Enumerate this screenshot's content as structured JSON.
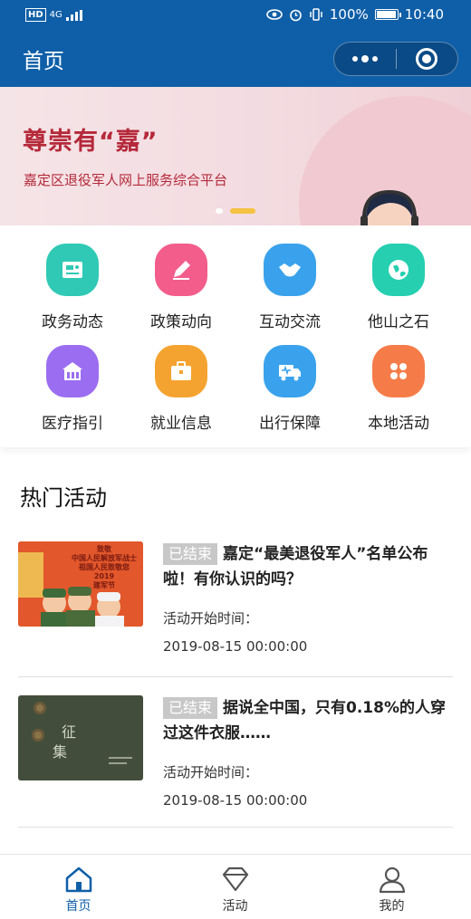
{
  "status_bar": {
    "hd": "HD",
    "signal": "4G",
    "battery": "100%",
    "time": "10:40"
  },
  "nav": {
    "title": "首页"
  },
  "banner": {
    "title": "尊崇有“嘉”",
    "subtitle": "嘉定区退役军人网上服务综合平台"
  },
  "grid": {
    "items": [
      {
        "label": "政务动态",
        "icon": "news-icon",
        "color": "#2fc9b5"
      },
      {
        "label": "政策动向",
        "icon": "pen-icon",
        "color": "#f25d8c"
      },
      {
        "label": "互动交流",
        "icon": "handshake-icon",
        "color": "#3aa2ec"
      },
      {
        "label": "他山之石",
        "icon": "globe-icon",
        "color": "#25cfb0"
      },
      {
        "label": "医疗指引",
        "icon": "hospital-icon",
        "color": "#9b6df0"
      },
      {
        "label": "就业信息",
        "icon": "briefcase-icon",
        "color": "#f5a330"
      },
      {
        "label": "出行保障",
        "icon": "truck-icon",
        "color": "#3aa2ec"
      },
      {
        "label": "本地活动",
        "icon": "flower-icon",
        "color": "#f57c48"
      }
    ]
  },
  "hot": {
    "title": "热门活动",
    "items": [
      {
        "badge": "已结束",
        "title": "嘉定“最美退役军人”名单公布啦！有你认识的吗？",
        "time_label": "活动开始时间：",
        "time": "2019-08-15 00:00:00",
        "thumb_lines": [
          "致敬",
          "中国人民解放军战士",
          "祖国人民致敬您",
          "2019",
          "建军节"
        ]
      },
      {
        "badge": "已结束",
        "title": "据说全中国，只有0.18%的人穿过这件衣服……",
        "time_label": "活动开始时间：",
        "time": "2019-08-15 00:00:00",
        "thumb_lines": [
          "征",
          "集"
        ]
      }
    ]
  },
  "tabbar": {
    "items": [
      {
        "label": "首页",
        "icon": "home-icon",
        "active": true
      },
      {
        "label": "活动",
        "icon": "diamond-icon",
        "active": false
      },
      {
        "label": "我的",
        "icon": "user-icon",
        "active": false
      }
    ]
  },
  "colors": {
    "brand": "#0f5fa8",
    "banner_text": "#b5293a",
    "badge_bg": "#c8c8c8"
  }
}
